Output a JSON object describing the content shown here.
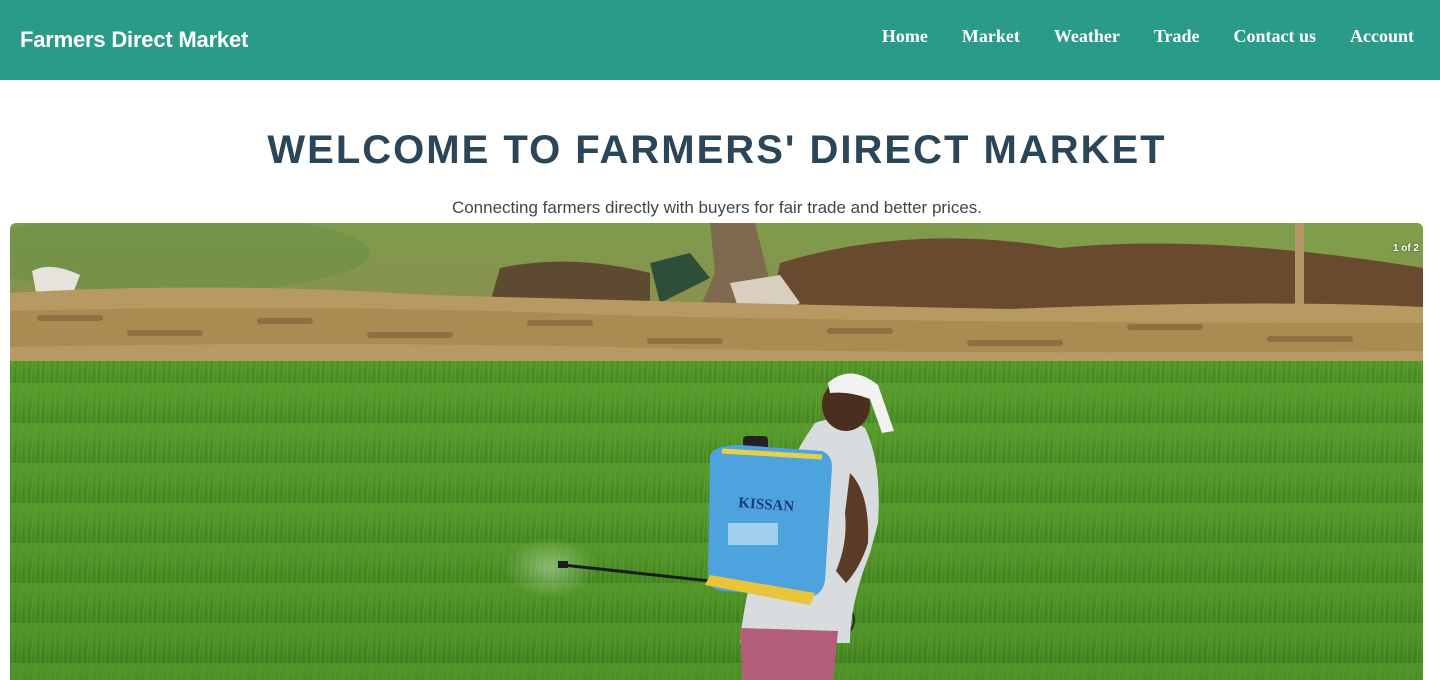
{
  "header": {
    "brand": "Farmers Direct Market",
    "nav": [
      "Home",
      "Market",
      "Weather",
      "Trade",
      "Contact us",
      "Account"
    ]
  },
  "hero": {
    "title": "WELCOME TO FARMERS' DIRECT MARKET",
    "subtitle": "Connecting farmers directly with buyers for fair trade and better prices."
  },
  "slideshow": {
    "counter": "1 of 2",
    "sprayer_label": "KISSAN"
  },
  "colors": {
    "header_bg": "#2a9a89",
    "title": "#2b4559"
  }
}
